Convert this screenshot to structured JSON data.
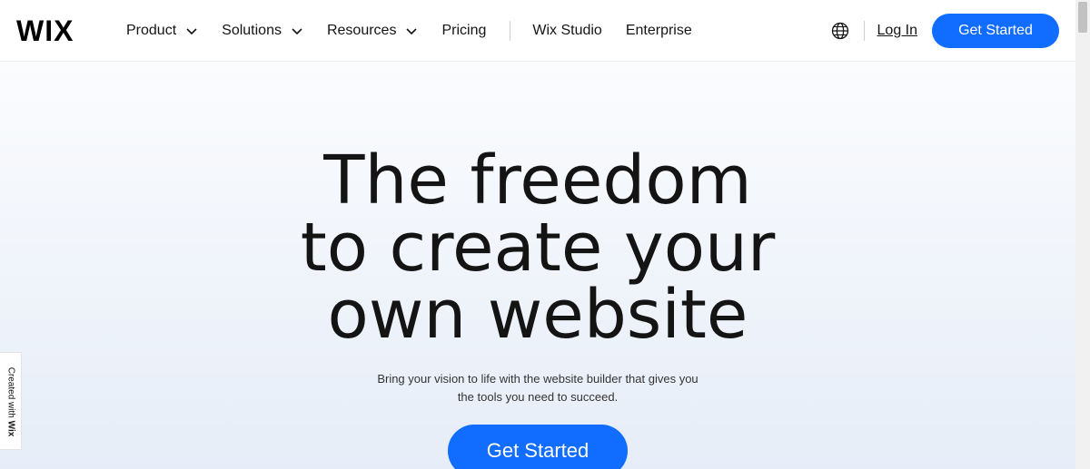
{
  "header": {
    "logo": "WIX",
    "nav": [
      {
        "label": "Product",
        "has_dropdown": true
      },
      {
        "label": "Solutions",
        "has_dropdown": true
      },
      {
        "label": "Resources",
        "has_dropdown": true
      },
      {
        "label": "Pricing",
        "has_dropdown": false
      },
      {
        "label": "Wix Studio",
        "has_dropdown": false
      },
      {
        "label": "Enterprise",
        "has_dropdown": false
      }
    ],
    "globe_icon": "globe-icon",
    "login_label": "Log In",
    "cta_label": "Get Started"
  },
  "hero": {
    "headline_lines": [
      "The freedom",
      "to create your",
      "own website"
    ],
    "subtext_lines": [
      "Bring your vision to life with the website builder that gives you",
      "the tools you need to succeed."
    ],
    "cta_label": "Get Started"
  },
  "badge": {
    "prefix": "Created with ",
    "brand": "Wix"
  },
  "colors": {
    "accent": "#116dff",
    "text": "#141414"
  }
}
